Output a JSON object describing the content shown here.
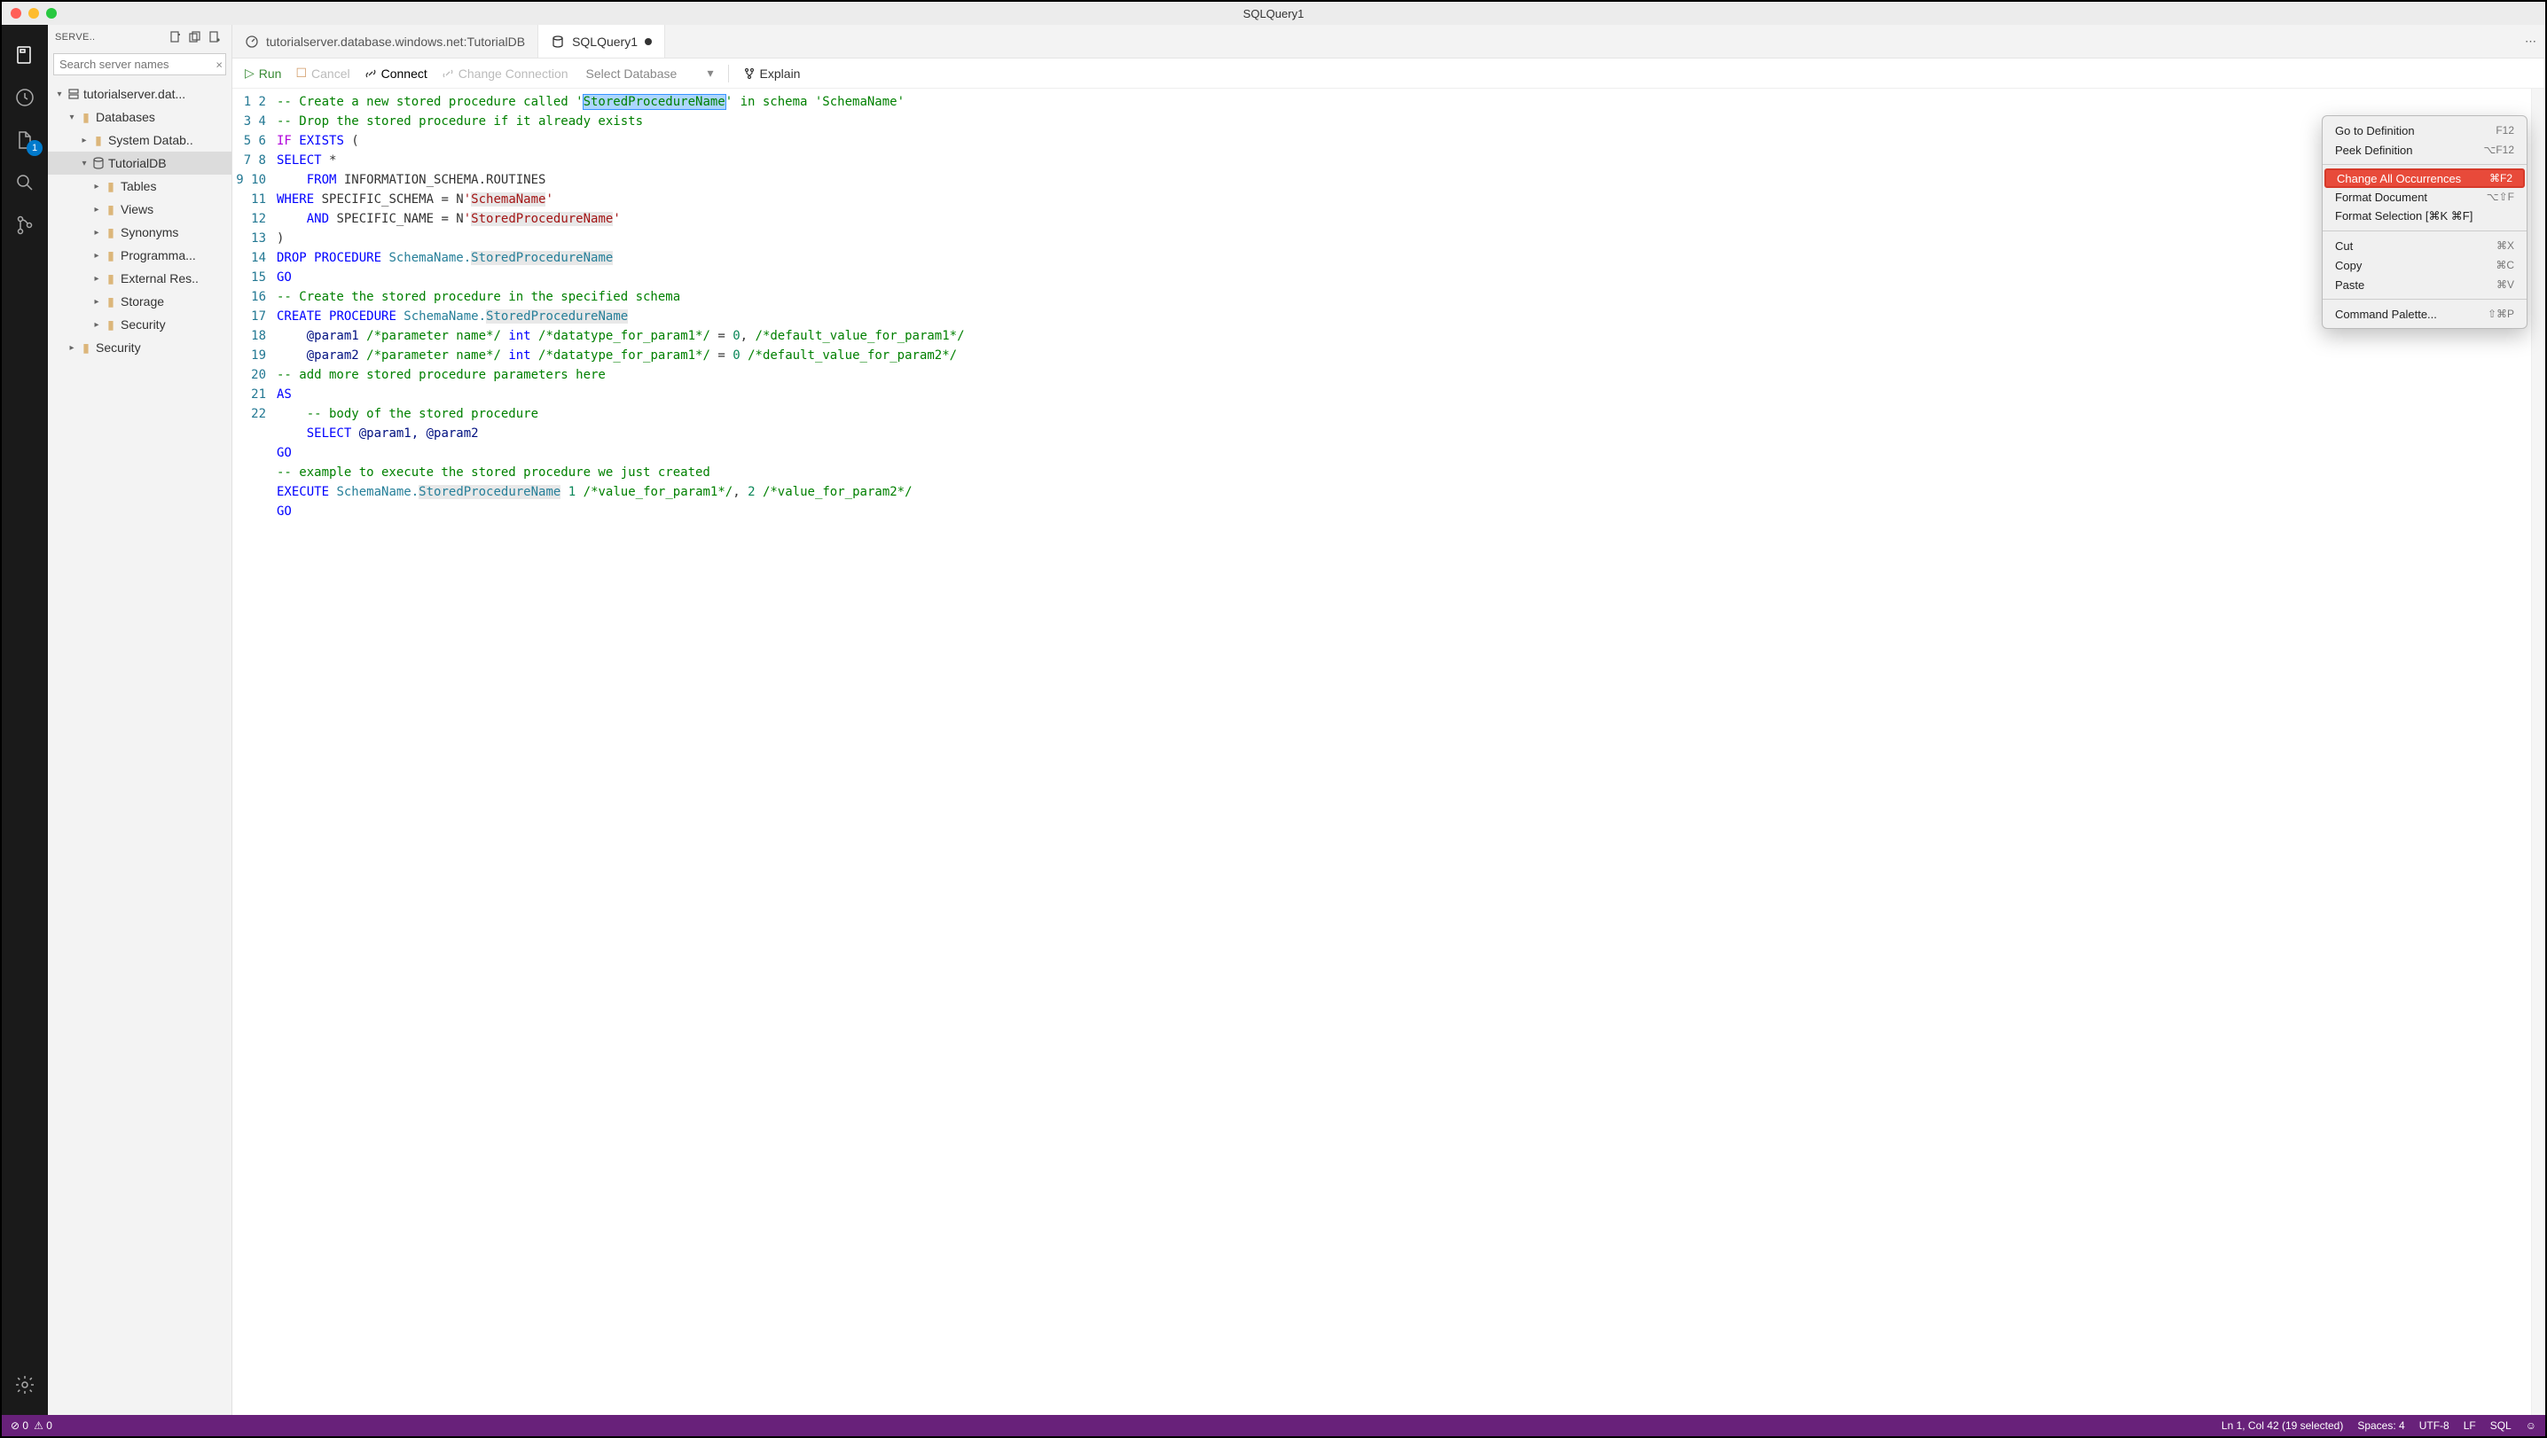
{
  "window": {
    "title": "SQLQuery1"
  },
  "activitybar": {
    "badge_count": "1"
  },
  "sidebar": {
    "header": {
      "title": "SERVE.."
    },
    "search_placeholder": "Search server names",
    "tree": {
      "server": "tutorialserver.dat...",
      "databases": "Databases",
      "system_db": "System Datab..",
      "tutorial_db": "TutorialDB",
      "tables": "Tables",
      "views": "Views",
      "synonyms": "Synonyms",
      "programma": "Programma...",
      "external": "External Res..",
      "storage": "Storage",
      "security_inner": "Security",
      "security_outer": "Security"
    }
  },
  "tabs": {
    "t0": "tutorialserver.database.windows.net:TutorialDB",
    "t1": "SQLQuery1"
  },
  "toolbar": {
    "run": "Run",
    "cancel": "Cancel",
    "connect": "Connect",
    "change_conn": "Change Connection",
    "select_db": "Select Database",
    "explain": "Explain"
  },
  "code": {
    "l1a": "-- Create a new stored procedure called '",
    "l1b": "StoredProcedureName",
    "l1c": "' in schema 'SchemaName'",
    "l2": "-- Drop the stored procedure if it already exists",
    "l3a": "IF",
    "l3b": "EXISTS",
    "l3c": " (",
    "l4a": "SELECT",
    "l4b": " *",
    "l5a": "    ",
    "l5b": "FROM",
    "l5c": " INFORMATION_SCHEMA.ROUTINES",
    "l6a": "WHERE",
    "l6b": " SPECIFIC_SCHEMA = N",
    "l6c": "'",
    "l6d": "SchemaName",
    "l6e": "'",
    "l7a": "    ",
    "l7b": "AND",
    "l7c": " SPECIFIC_NAME = N",
    "l7d": "'",
    "l7e": "StoredProcedureName",
    "l7f": "'",
    "l8": ")",
    "l9a": "DROP",
    "l9b": "PROCEDURE",
    "l9c": " SchemaName.",
    "l9d": "StoredProcedureName",
    "l10": "GO",
    "l11": "-- Create the stored procedure in the specified schema",
    "l12a": "CREATE",
    "l12b": "PROCEDURE",
    "l12c": " SchemaName.",
    "l12d": "StoredProcedureName",
    "l13a": "    @param1 ",
    "l13b": "/*parameter name*/",
    "l13c": "int",
    "l13d": "/*datatype_for_param1*/",
    "l13e": " = ",
    "l13f": "0",
    "l13g": ", ",
    "l13h": "/*default_value_for_param1*/",
    "l14a": "    @param2 ",
    "l14b": "/*parameter name*/",
    "l14c": "int",
    "l14d": "/*datatype_for_param1*/",
    "l14e": " = ",
    "l14f": "0",
    "l14g": " ",
    "l14h": "/*default_value_for_param2*/",
    "l15": "-- add more stored procedure parameters here",
    "l16": "AS",
    "l17a": "    ",
    "l17b": "-- body of the stored procedure",
    "l18a": "    ",
    "l18b": "SELECT",
    "l18c": " @param1, @param2",
    "l19": "GO",
    "l20": "-- example to execute the stored procedure we just created",
    "l21a": "EXECUTE",
    "l21b": " SchemaName.",
    "l21c": "StoredProcedureName",
    "l21d": " ",
    "l21e": "1",
    "l21f": " ",
    "l21g": "/*value_for_param1*/",
    "l21h": ", ",
    "l21i": "2",
    "l21j": " ",
    "l21k": "/*value_for_param2*/",
    "l22": "GO"
  },
  "context_menu": {
    "goto_def": {
      "label": "Go to Definition",
      "sc": "F12"
    },
    "peek_def": {
      "label": "Peek Definition",
      "sc": "⌥F12"
    },
    "change_all": {
      "label": "Change All Occurrences",
      "sc": "⌘F2"
    },
    "format_doc": {
      "label": "Format Document",
      "sc": "⌥⇧F"
    },
    "format_sel": {
      "label": "Format Selection [⌘K ⌘F]",
      "sc": ""
    },
    "cut": {
      "label": "Cut",
      "sc": "⌘X"
    },
    "copy": {
      "label": "Copy",
      "sc": "⌘C"
    },
    "paste": {
      "label": "Paste",
      "sc": "⌘V"
    },
    "palette": {
      "label": "Command Palette...",
      "sc": "⇧⌘P"
    }
  },
  "statusbar": {
    "errors": "0",
    "warnings": "0",
    "cursor": "Ln 1, Col 42 (19 selected)",
    "spaces": "Spaces: 4",
    "encoding": "UTF-8",
    "eol": "LF",
    "lang": "SQL"
  }
}
